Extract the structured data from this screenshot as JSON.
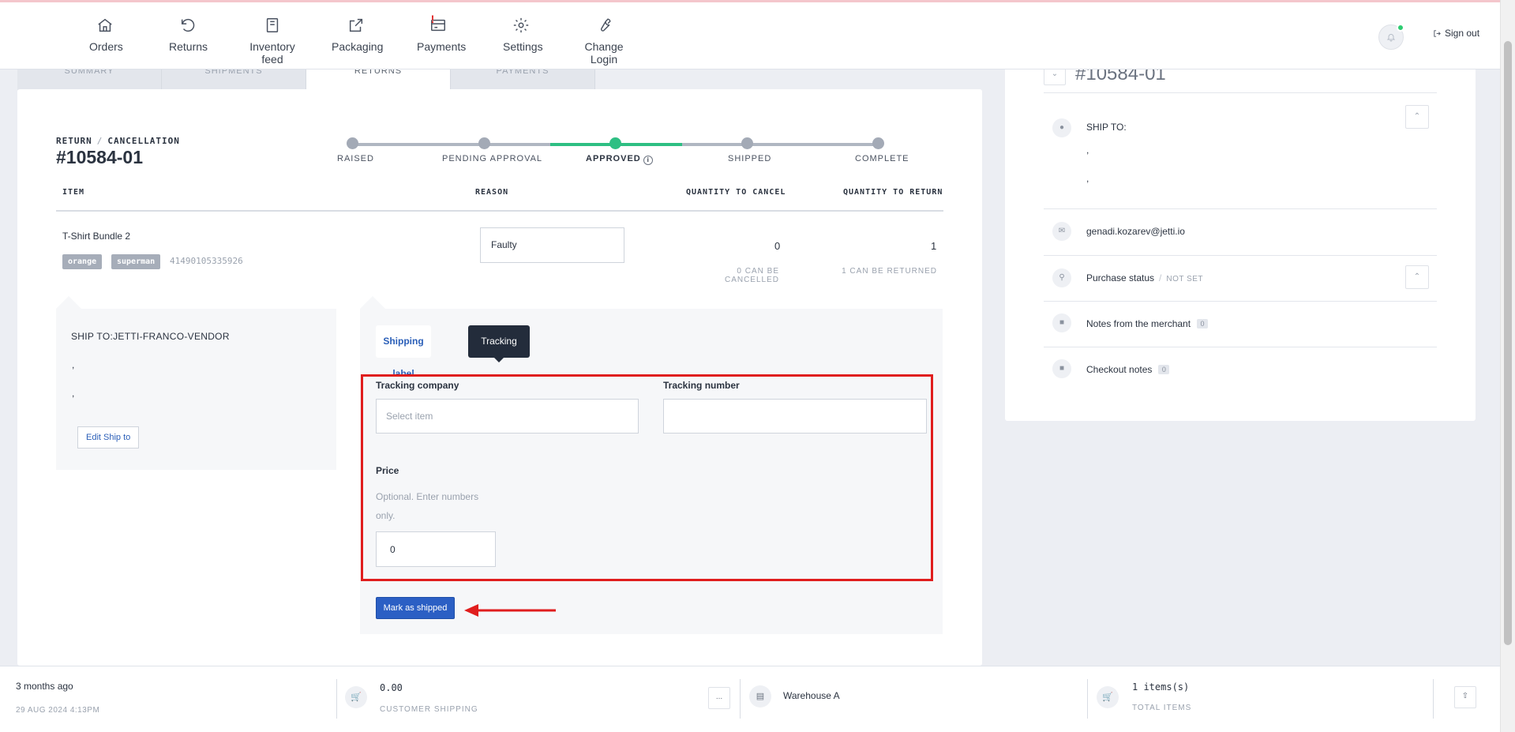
{
  "nav": {
    "items": [
      {
        "label": "Orders",
        "icon": "home-icon"
      },
      {
        "label": "Returns",
        "icon": "undo-icon"
      },
      {
        "label": "Inventory feed",
        "icon": "book-icon"
      },
      {
        "label": "Packaging",
        "icon": "external-link-icon"
      },
      {
        "label": "Payments",
        "icon": "credit-card-icon",
        "alert": "!"
      },
      {
        "label": "Settings",
        "icon": "gear-icon"
      },
      {
        "label": "Change Login",
        "icon": "wrench-icon"
      }
    ],
    "sign_out": "Sign out"
  },
  "tabs": [
    "SUMMARY",
    "SHIPMENTS",
    "RETURNS",
    "PAYMENTS"
  ],
  "return": {
    "type_label": "RETURN",
    "subtype_label": "CANCELLATION",
    "number": "#10584-01",
    "steps": [
      {
        "label": "RAISED",
        "active": false
      },
      {
        "label": "PENDING APPROVAL",
        "active": false
      },
      {
        "label": "APPROVED",
        "active": true,
        "info_icon": "i"
      },
      {
        "label": "SHIPPED",
        "active": false
      },
      {
        "label": "COMPLETE",
        "active": false
      }
    ]
  },
  "table": {
    "headers": {
      "item": "ITEM",
      "reason": "REASON",
      "qty_cancel": "QUANTITY TO CANCEL",
      "qty_return": "QUANTITY TO RETURN"
    },
    "row": {
      "name": "T-Shirt Bundle 2",
      "tags": [
        "orange",
        "superman"
      ],
      "sku": "41490105335926",
      "reason": "Faulty",
      "qty_cancel": "0",
      "qty_return": "1",
      "cancel_note": "0 CAN BE CANCELLED",
      "return_note": "1 CAN BE RETURNED"
    }
  },
  "ship_to": {
    "title": "SHIP TO:JETTI-FRANCO-VENDOR",
    "line1": ",",
    "line2": ",",
    "edit_button": "Edit Ship to"
  },
  "tracking": {
    "tab_shipping_label": "Shipping label",
    "tab_tracking": "Tracking",
    "company_label": "Tracking company",
    "company_placeholder": "Select item",
    "number_label": "Tracking number",
    "number_value": "",
    "price_label": "Price",
    "price_help": "Optional. Enter numbers only.",
    "price_value": "0",
    "submit": "Mark as shipped",
    "annotation_color": "#e01e1e"
  },
  "right": {
    "order_number": "#10584-01",
    "ship_to_label": "SHIP TO:",
    "ship_line1": ",",
    "ship_line2": ",",
    "email": "genadi.kozarev@jetti.io",
    "purchase_status_label": "Purchase status",
    "purchase_status_value": "NOT SET",
    "merchant_notes_label": "Notes from the merchant",
    "merchant_notes_count": "0",
    "checkout_notes_label": "Checkout notes",
    "checkout_notes_count": "0"
  },
  "footer": {
    "time_ago": "3 months ago",
    "date": "29 AUG 2024 4:13PM",
    "shipping_value": "0.00",
    "shipping_label": "CUSTOMER SHIPPING",
    "more_button": "...",
    "warehouse": "Warehouse A",
    "items_value": "1 items(s)",
    "items_label": "TOTAL ITEMS"
  },
  "colors": {
    "primary": "#2b5fc4",
    "success": "#2ebf83",
    "dark": "#232c3b",
    "alert": "#e02424"
  }
}
